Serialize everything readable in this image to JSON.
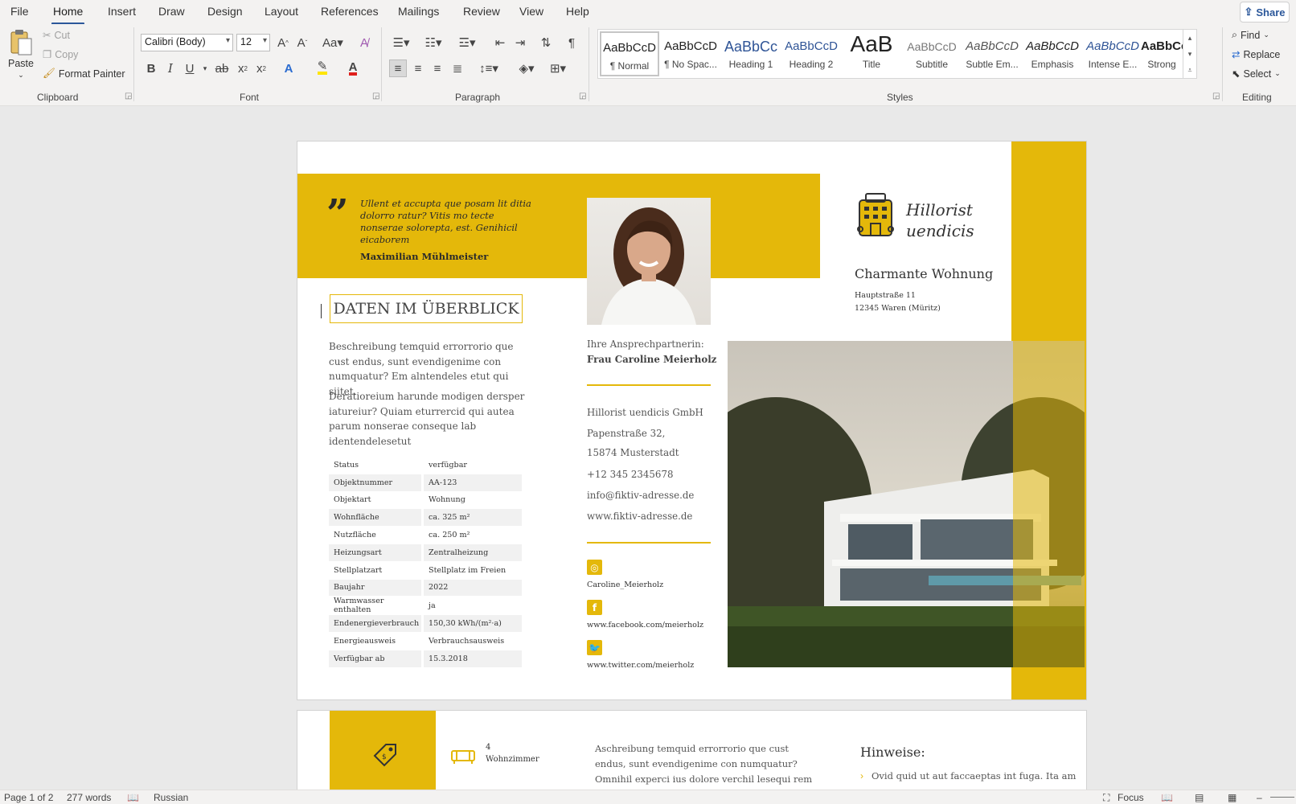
{
  "menu": {
    "tabs": [
      "File",
      "Home",
      "Insert",
      "Draw",
      "Design",
      "Layout",
      "References",
      "Mailings",
      "Review",
      "View",
      "Help"
    ],
    "active": "Home",
    "share_label": "Share"
  },
  "ribbon": {
    "clipboard": {
      "label": "Clipboard",
      "paste": "Paste",
      "cut": "Cut",
      "copy": "Copy",
      "format_painter": "Format Painter"
    },
    "font": {
      "label": "Font",
      "family": "Calibri (Body)",
      "size": "12"
    },
    "paragraph": {
      "label": "Paragraph"
    },
    "styles": {
      "label": "Styles",
      "items": [
        {
          "preview": "AaBbCcD",
          "name": "¶ Normal"
        },
        {
          "preview": "AaBbCcD",
          "name": "¶ No Spac..."
        },
        {
          "preview": "AaBbCc",
          "name": "Heading 1"
        },
        {
          "preview": "AaBbCcD",
          "name": "Heading 2"
        },
        {
          "preview": "AaB",
          "name": "Title"
        },
        {
          "preview": "AaBbCcD",
          "name": "Subtitle"
        },
        {
          "preview": "AaBbCcD",
          "name": "Subtle Em..."
        },
        {
          "preview": "AaBbCcD",
          "name": "Emphasis"
        },
        {
          "preview": "AaBbCcD",
          "name": "Intense E..."
        },
        {
          "preview": "AaBbCcD",
          "name": "Strong"
        }
      ]
    },
    "editing": {
      "label": "Editing",
      "find": "Find",
      "replace": "Replace",
      "select": "Select"
    }
  },
  "colors": {
    "accent": "#e4b80a",
    "ribbon_bg": "#f3f2f1",
    "word_blue": "#2b579a"
  },
  "doc": {
    "quote": {
      "text": "Ullent et accupta que posam lit ditia dolorro ratur? Vitis mo tecte nonserae solorepta, est. Genihicil eicaborem",
      "author": "Maximilian Mühlmeister"
    },
    "heading": "DATEN IM ÜBERBLICK",
    "paragraphs": [
      "Beschreibung temquid errorrorio que  cust endus, sunt evendigenime con numquatur? Em alntendeles etut qui siitet.",
      "Deratioreium harunde modigen dersper iatureiur? Quiam eturrercid qui autea parum nonserae conseque lab identendelesetut"
    ],
    "table": [
      [
        "Status",
        "verfügbar"
      ],
      [
        "Objektnummer",
        "AA-123"
      ],
      [
        "Objektart",
        "Wohnung"
      ],
      [
        "Wohnfläche",
        "ca. 325 m²"
      ],
      [
        "Nutzfläche",
        "ca. 250 m²"
      ],
      [
        "Heizungsart",
        "Zentralheizung"
      ],
      [
        "Stellplatzart",
        "Stellplatz im Freien"
      ],
      [
        "Baujahr",
        "2022"
      ],
      [
        "Warmwasser enthalten",
        "ja"
      ],
      [
        "Endenergieverbrauch",
        "150,30 kWh/(m²·a)"
      ],
      [
        "Energieausweis",
        "Verbrauchsausweis"
      ],
      [
        "Verfügbar ab",
        "15.3.2018"
      ]
    ],
    "contact": {
      "intro": "Ihre Ansprechpartnerin:",
      "name": "Frau Caroline Meierholz",
      "company": "Hillorist uendicis GmbH",
      "street": "Papenstraße 32,",
      "city": "15874 Musterstadt",
      "phone": "+12 345 2345678",
      "email": "info@fiktiv-adresse.de",
      "web": "www.fiktiv-adresse.de",
      "instagram": "Caroline_Meierholz",
      "facebook": "www.facebook.com/meierholz",
      "twitter": "www.twitter.com/meierholz"
    },
    "brand": {
      "line1": "Hillorist",
      "line2": "uendicis"
    },
    "property": {
      "title": "Charmante Wohnung",
      "street": "Hauptstraße 11",
      "city": "12345 Waren (Müritz)"
    },
    "page2": {
      "rooms_count": "4",
      "rooms_label": "Wohnzimmer",
      "text_line1": "Aschreibung temquid errorrorio que cust",
      "text_line2": "endus, sunt evendigenime con numquatur?",
      "text_line3": "Omnihil experci ius dolore verchil lesequi rem",
      "hints_title": "Hinweise:",
      "hint1": "Ovid quid ut aut faccaeptas int fuga. Ita am"
    }
  },
  "status": {
    "page": "Page 1 of 2",
    "words": "277 words",
    "language": "Russian",
    "focus": "Focus"
  }
}
